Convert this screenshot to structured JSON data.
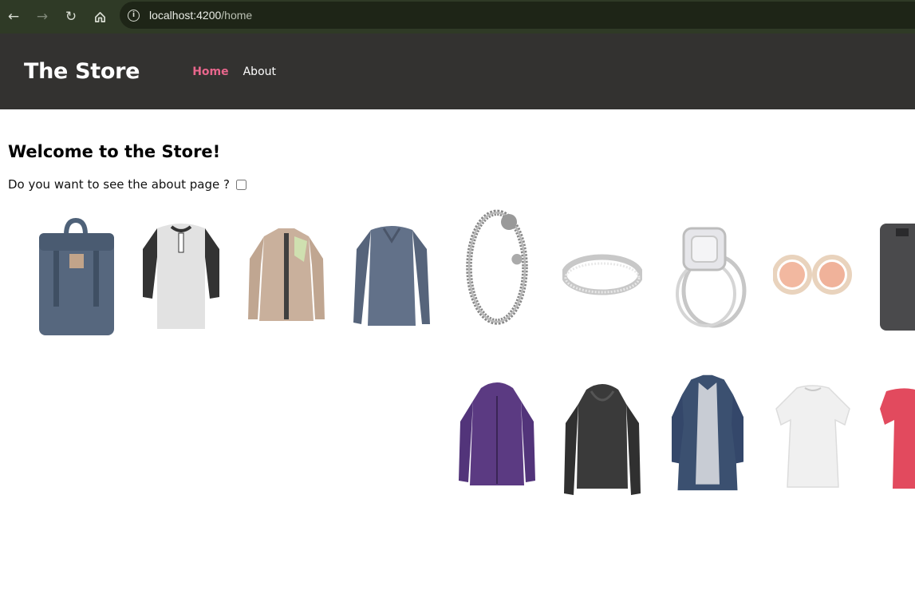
{
  "browser": {
    "url_host": "localhost:4200",
    "url_path": "/home"
  },
  "header": {
    "brand": "The Store",
    "nav": [
      {
        "label": "Home",
        "active": true
      },
      {
        "label": "About",
        "active": false
      }
    ]
  },
  "main": {
    "title": "Welcome to the Store!",
    "question": "Do you want to see the about page ?"
  },
  "colors": {
    "browser_bar": "#2f3a26",
    "header_bg": "#333230",
    "nav_active": "#e8668c"
  },
  "products": [
    {
      "name": "backpack-icon"
    },
    {
      "name": "henley-shirt-icon"
    },
    {
      "name": "jacket-icon"
    },
    {
      "name": "long-sleeve-shirt-icon"
    },
    {
      "name": "bracelet-icon"
    },
    {
      "name": "ring-icon"
    },
    {
      "name": "engagement-ring-icon"
    },
    {
      "name": "rings-pair-icon"
    },
    {
      "name": "hard-drive-icon"
    },
    {
      "name": "purple-jacket-icon"
    },
    {
      "name": "leather-jacket-icon"
    },
    {
      "name": "denim-coat-icon"
    },
    {
      "name": "white-top-icon"
    },
    {
      "name": "pink-top-icon"
    }
  ]
}
